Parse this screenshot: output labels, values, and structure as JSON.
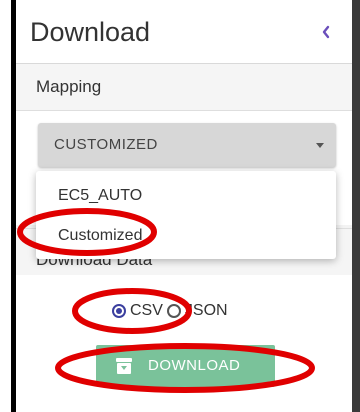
{
  "header": {
    "title": "Download",
    "collapse_icon": "chevron-left-icon",
    "accent_color": "#6b4fbb"
  },
  "mapping": {
    "label": "Mapping",
    "selected_value": "CUSTOMIZED",
    "options": [
      "EC5_AUTO",
      "Customized"
    ]
  },
  "download": {
    "label": "Download Data",
    "format_options": [
      {
        "label": "CSV",
        "checked": true
      },
      {
        "label": "JSON",
        "checked": false
      }
    ],
    "button_label": "DOWNLOAD",
    "button_icon": "archive-download-icon",
    "button_color": "#7ac29a"
  },
  "annotation_color": "#e00000"
}
